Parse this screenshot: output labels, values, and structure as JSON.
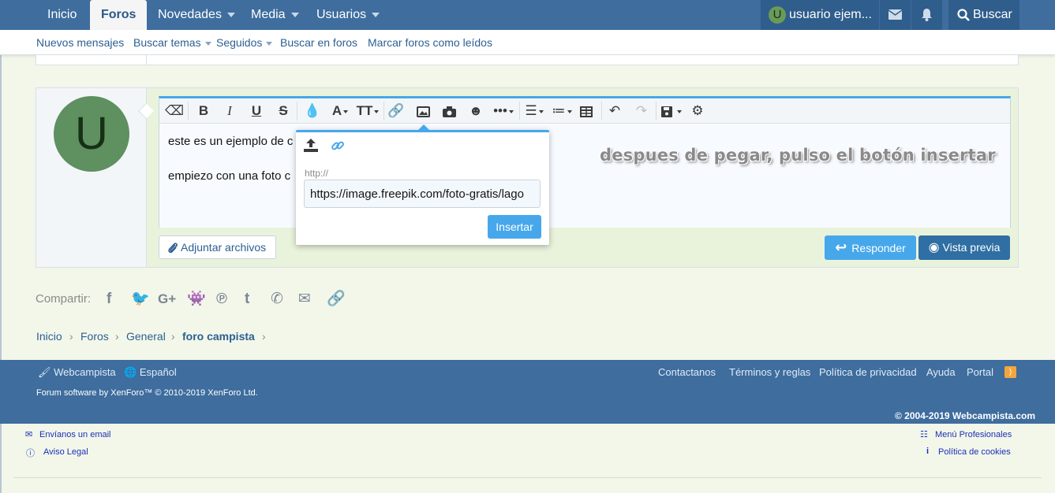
{
  "topnav": {
    "tabs": [
      {
        "label": "Inicio"
      },
      {
        "label": "Foros"
      },
      {
        "label": "Novedades"
      },
      {
        "label": "Media"
      },
      {
        "label": "Usuarios"
      }
    ],
    "user_initial": "U",
    "user_name": "usuario ejem...",
    "search_label": "Buscar"
  },
  "subnav": {
    "items": [
      "Nuevos mensajes",
      "Buscar temas",
      "Seguidos",
      "Buscar en foros",
      "Marcar foros como leídos"
    ]
  },
  "reply": {
    "avatar_initial": "U",
    "lines": [
      "este es un ejemplo de c",
      "empiezo con una foto c"
    ],
    "attach_label": "Adjuntar archivos",
    "reply_label": "Responder",
    "preview_label": "Vista previa"
  },
  "annotation": "despues de pegar, pulso el botón insertar",
  "popup": {
    "label": "http://",
    "url_value": "https://image.freepik.com/foto-gratis/lago",
    "insert_label": "Insertar"
  },
  "share": {
    "label": "Compartir:"
  },
  "breadcrumb": [
    "Inicio",
    "Foros",
    "General",
    "foro campista"
  ],
  "footer": {
    "style_label": "Webcampista",
    "lang_label": "Español",
    "links": [
      "Contactanos",
      "Términos y reglas",
      "Política de privacidad",
      "Ayuda",
      "Portal"
    ],
    "software": "Forum software by XenForo™ © 2010-2019 XenForo Ltd.",
    "copyright": "© 2004-2019 Webcampista.com"
  },
  "bottom": {
    "email": "Envíanos un email",
    "legal": "Aviso Legal",
    "pros": "Menú Profesionales",
    "cookies": "Política de cookies"
  },
  "colors": {
    "nav": "#3e6d9e",
    "accent": "#47a7eb",
    "button_dark": "#2f6fa3",
    "background": "#f2f7ea"
  }
}
